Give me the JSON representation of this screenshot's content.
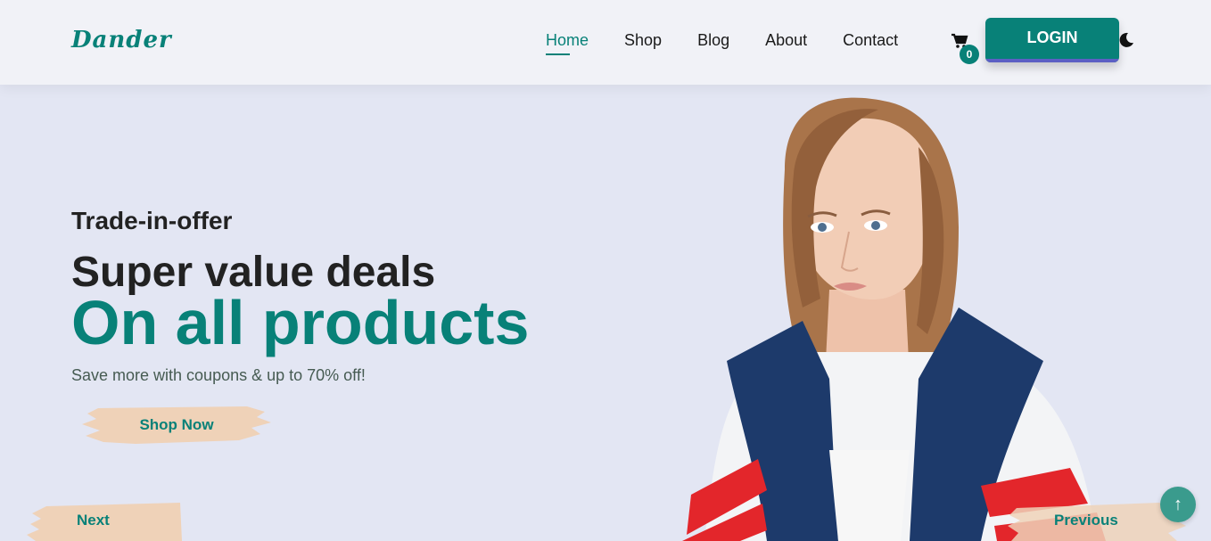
{
  "brand": {
    "logo": "Dander",
    "accent": "#088178"
  },
  "nav": {
    "links": [
      {
        "label": "Home",
        "active": true
      },
      {
        "label": "Shop",
        "active": false
      },
      {
        "label": "Blog",
        "active": false
      },
      {
        "label": "About",
        "active": false
      },
      {
        "label": "Contact",
        "active": false
      }
    ],
    "cart_icon": "cart-icon",
    "cart_count": "0",
    "login_label": "LOGIN",
    "theme_icon": "moon-icon"
  },
  "hero": {
    "eyebrow": "Trade-in-offer",
    "headline": "Super value deals",
    "headline_accent": "On all products",
    "subtext": "Save more with coupons & up to 70% off!",
    "cta_label": "Shop Now",
    "image": "model-photo"
  },
  "slider": {
    "next_label": "Next",
    "previous_label": "Previous"
  },
  "scroll_top_icon": "arrow-up-icon"
}
